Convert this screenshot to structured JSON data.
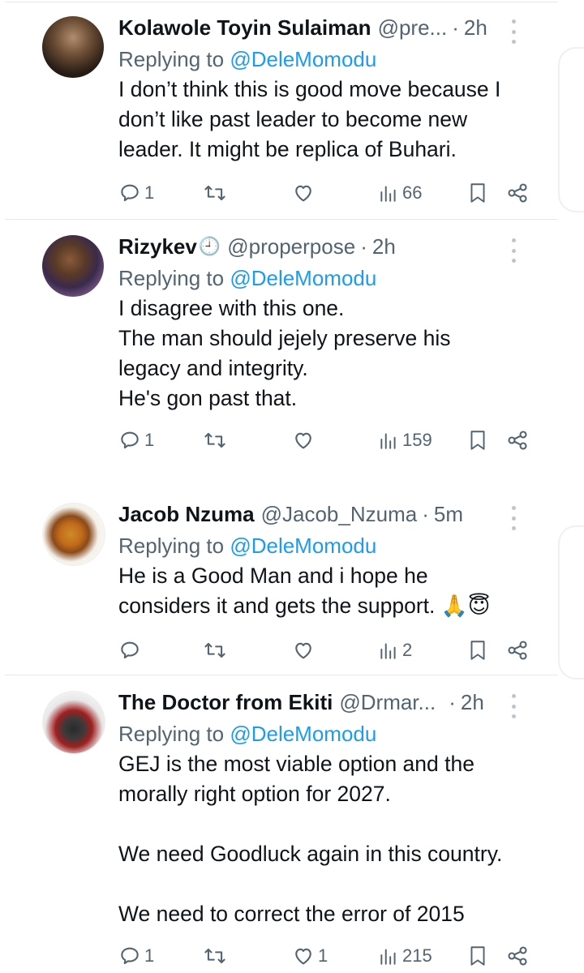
{
  "replying_label": "Replying to",
  "tweets": [
    {
      "name": "Kolawole Toyin Sulaiman",
      "handle": "@pre...",
      "time": "2h",
      "reply_to": "@DeleMomodu",
      "lines": [
        "I don’t think this is good move because I",
        "don’t like past leader to become new",
        "leader. It might be replica of Buhari."
      ],
      "replies": "1",
      "retweets": "",
      "likes": "",
      "views": "66"
    },
    {
      "name": "Rizykev",
      "name_emoji": "🕘",
      "handle": "@properpose",
      "time": "2h",
      "reply_to": "@DeleMomodu",
      "lines": [
        "I disagree with this one.",
        "The man should jejely preserve his",
        "legacy and integrity.",
        "He's gon past that."
      ],
      "replies": "1",
      "retweets": "",
      "likes": "",
      "views": "159"
    },
    {
      "name": "Jacob Nzuma",
      "handle": "@Jacob_Nzuma",
      "time": "5m",
      "reply_to": "@DeleMomodu",
      "lines": [
        "He is a Good Man and i hope he",
        "considers it and gets the support. 🙏😇"
      ],
      "replies": "",
      "retweets": "",
      "likes": "",
      "views": "2"
    },
    {
      "name": "The Doctor from Ekiti",
      "handle": "@Drmar...",
      "time": "2h",
      "reply_to": "@DeleMomodu",
      "lines": [
        "GEJ is the most viable option and the",
        "morally right option for 2027.",
        "",
        "We need Goodluck again in this country.",
        "",
        "We need to correct the error of 2015"
      ],
      "replies": "1",
      "retweets": "",
      "likes": "1",
      "views": "215"
    }
  ],
  "icons": {
    "reply": "comment-bubble-icon",
    "retweet": "retweet-icon",
    "like": "heart-icon",
    "views": "bar-chart-icon",
    "bookmark": "bookmark-icon",
    "share": "share-icon",
    "more": "more-vertical-icon"
  },
  "colors": {
    "text": "#0f1419",
    "muted": "#536471",
    "link": "#1d9bf0",
    "divider": "#e6e9eb"
  }
}
